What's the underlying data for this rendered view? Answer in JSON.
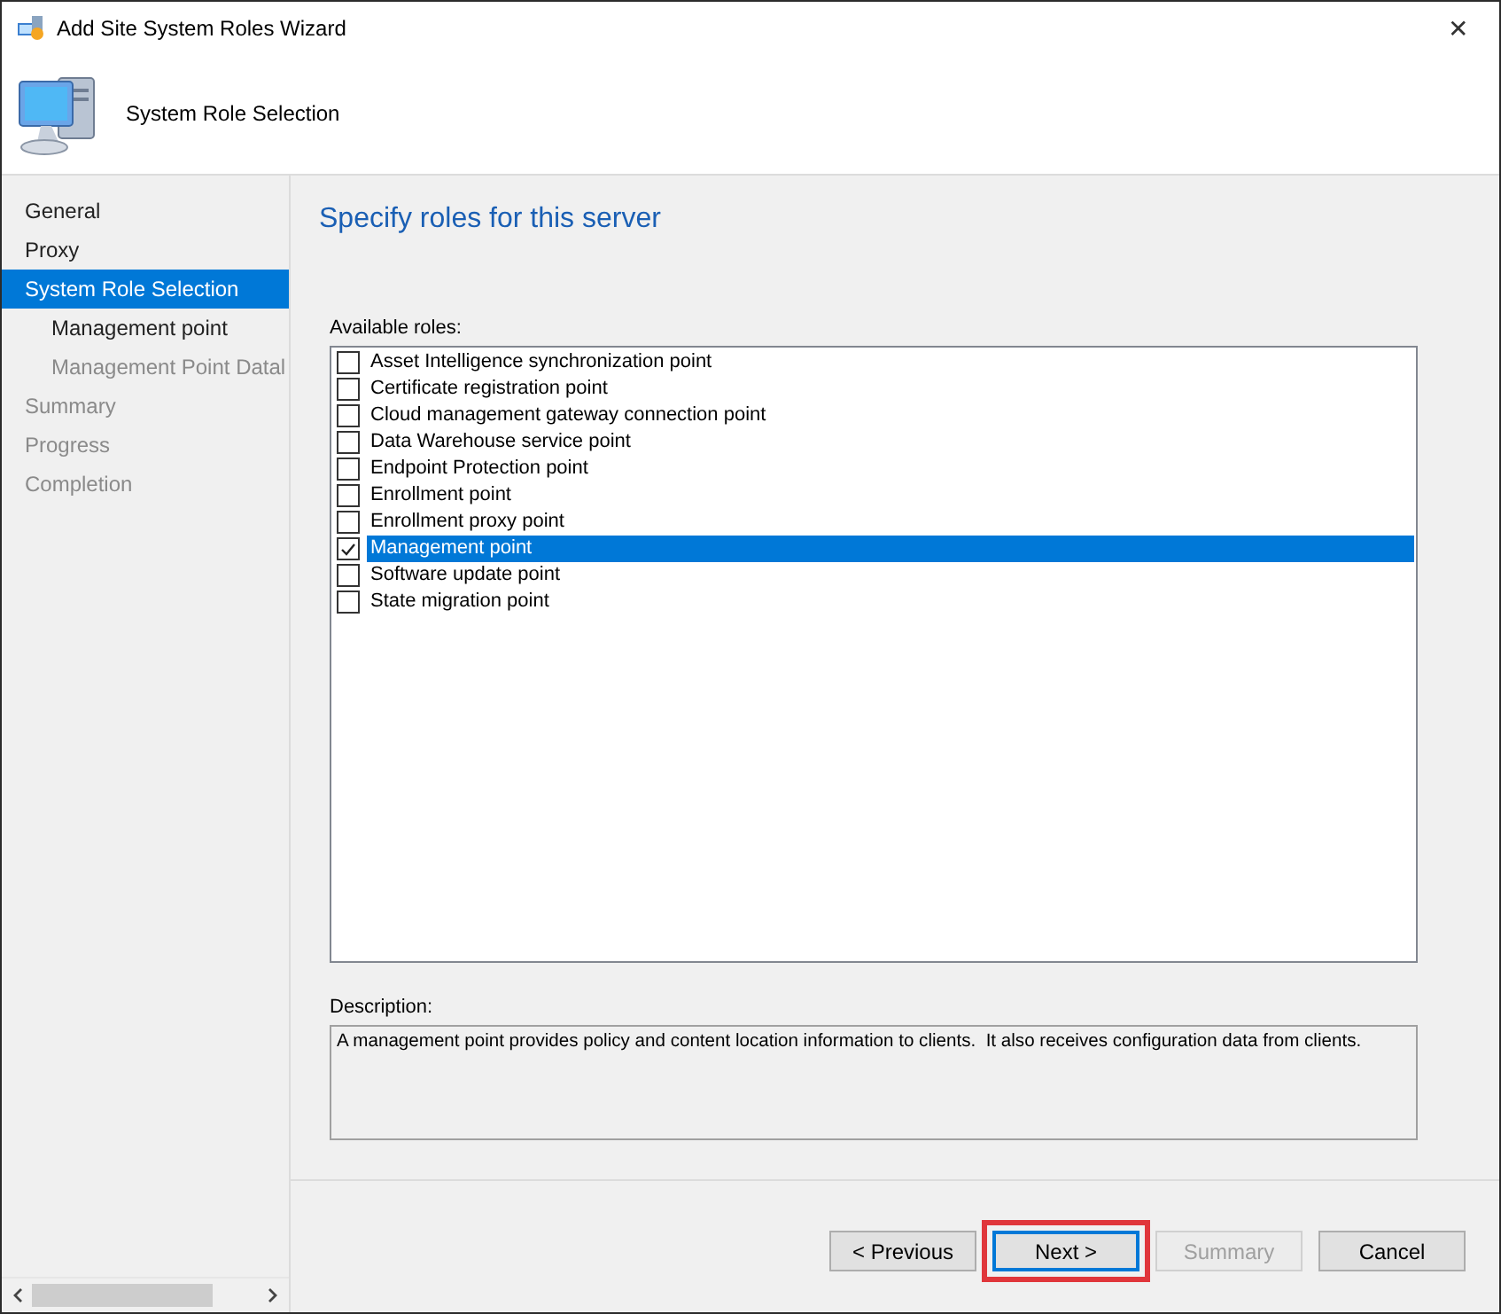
{
  "window": {
    "title": "Add Site System Roles Wizard",
    "close_glyph": "✕"
  },
  "header": {
    "title": "System Role Selection"
  },
  "nav": [
    {
      "label": "General",
      "selected": false,
      "disabled": false
    },
    {
      "label": "Proxy",
      "selected": false,
      "disabled": false
    },
    {
      "label": "System Role Selection",
      "selected": true,
      "disabled": false,
      "children": [
        {
          "label": "Management point",
          "selected": false,
          "disabled": false
        },
        {
          "label": "Management Point Datal",
          "selected": false,
          "disabled": true
        }
      ]
    },
    {
      "label": "Summary",
      "selected": false,
      "disabled": true
    },
    {
      "label": "Progress",
      "selected": false,
      "disabled": true
    },
    {
      "label": "Completion",
      "selected": false,
      "disabled": true
    }
  ],
  "page": {
    "heading": "Specify roles for this server",
    "roles_label": "Available roles:",
    "description_label": "Description:",
    "description": "A management point provides policy and content location information to clients.  It also receives configuration data from clients."
  },
  "roles": [
    {
      "label": "Asset Intelligence synchronization point",
      "checked": false,
      "selected": false
    },
    {
      "label": "Certificate registration point",
      "checked": false,
      "selected": false
    },
    {
      "label": "Cloud management gateway connection point",
      "checked": false,
      "selected": false
    },
    {
      "label": "Data Warehouse service point",
      "checked": false,
      "selected": false
    },
    {
      "label": "Endpoint Protection point",
      "checked": false,
      "selected": false
    },
    {
      "label": "Enrollment point",
      "checked": false,
      "selected": false
    },
    {
      "label": "Enrollment proxy point",
      "checked": false,
      "selected": false
    },
    {
      "label": "Management point",
      "checked": true,
      "selected": true
    },
    {
      "label": "Software update point",
      "checked": false,
      "selected": false
    },
    {
      "label": "State migration point",
      "checked": false,
      "selected": false
    }
  ],
  "buttons": [
    {
      "label": "< Previous",
      "disabled": false,
      "default": false,
      "highlighted": false
    },
    {
      "label": "Next >",
      "disabled": false,
      "default": true,
      "highlighted": true
    },
    {
      "label": "Summary",
      "disabled": true,
      "default": false,
      "highlighted": false
    },
    {
      "label": "Cancel",
      "disabled": false,
      "default": false,
      "highlighted": false
    }
  ]
}
